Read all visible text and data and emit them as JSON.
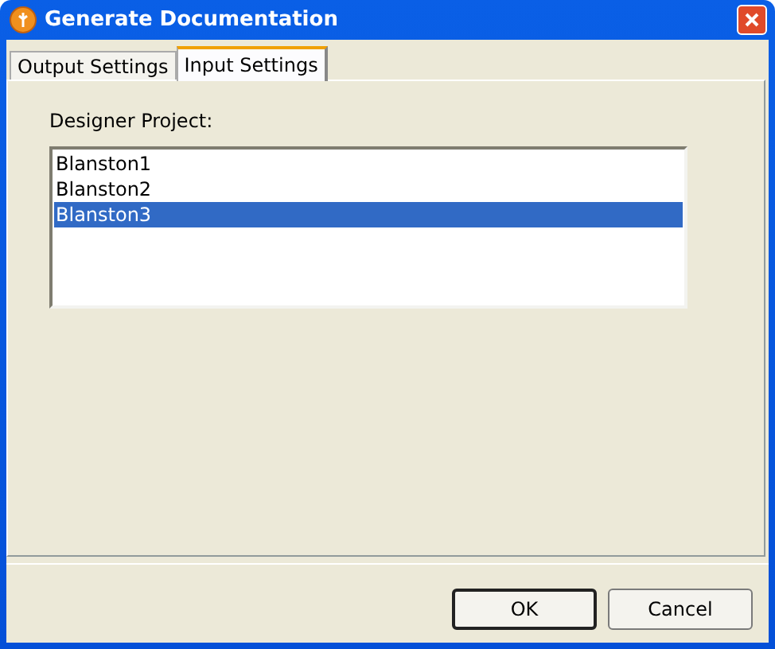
{
  "window": {
    "title": "Generate Documentation"
  },
  "tabs": [
    {
      "label": "Output Settings",
      "selected": false
    },
    {
      "label": "Input Settings",
      "selected": true
    }
  ],
  "designer_project": {
    "label": "Designer Project:",
    "items": [
      {
        "label": "Blanston1",
        "selected": false
      },
      {
        "label": "Blanston2",
        "selected": false
      },
      {
        "label": "Blanston3",
        "selected": true
      }
    ]
  },
  "buttons": [
    {
      "label": "OK",
      "kind": "default"
    },
    {
      "label": "Cancel",
      "kind": "normal"
    }
  ]
}
